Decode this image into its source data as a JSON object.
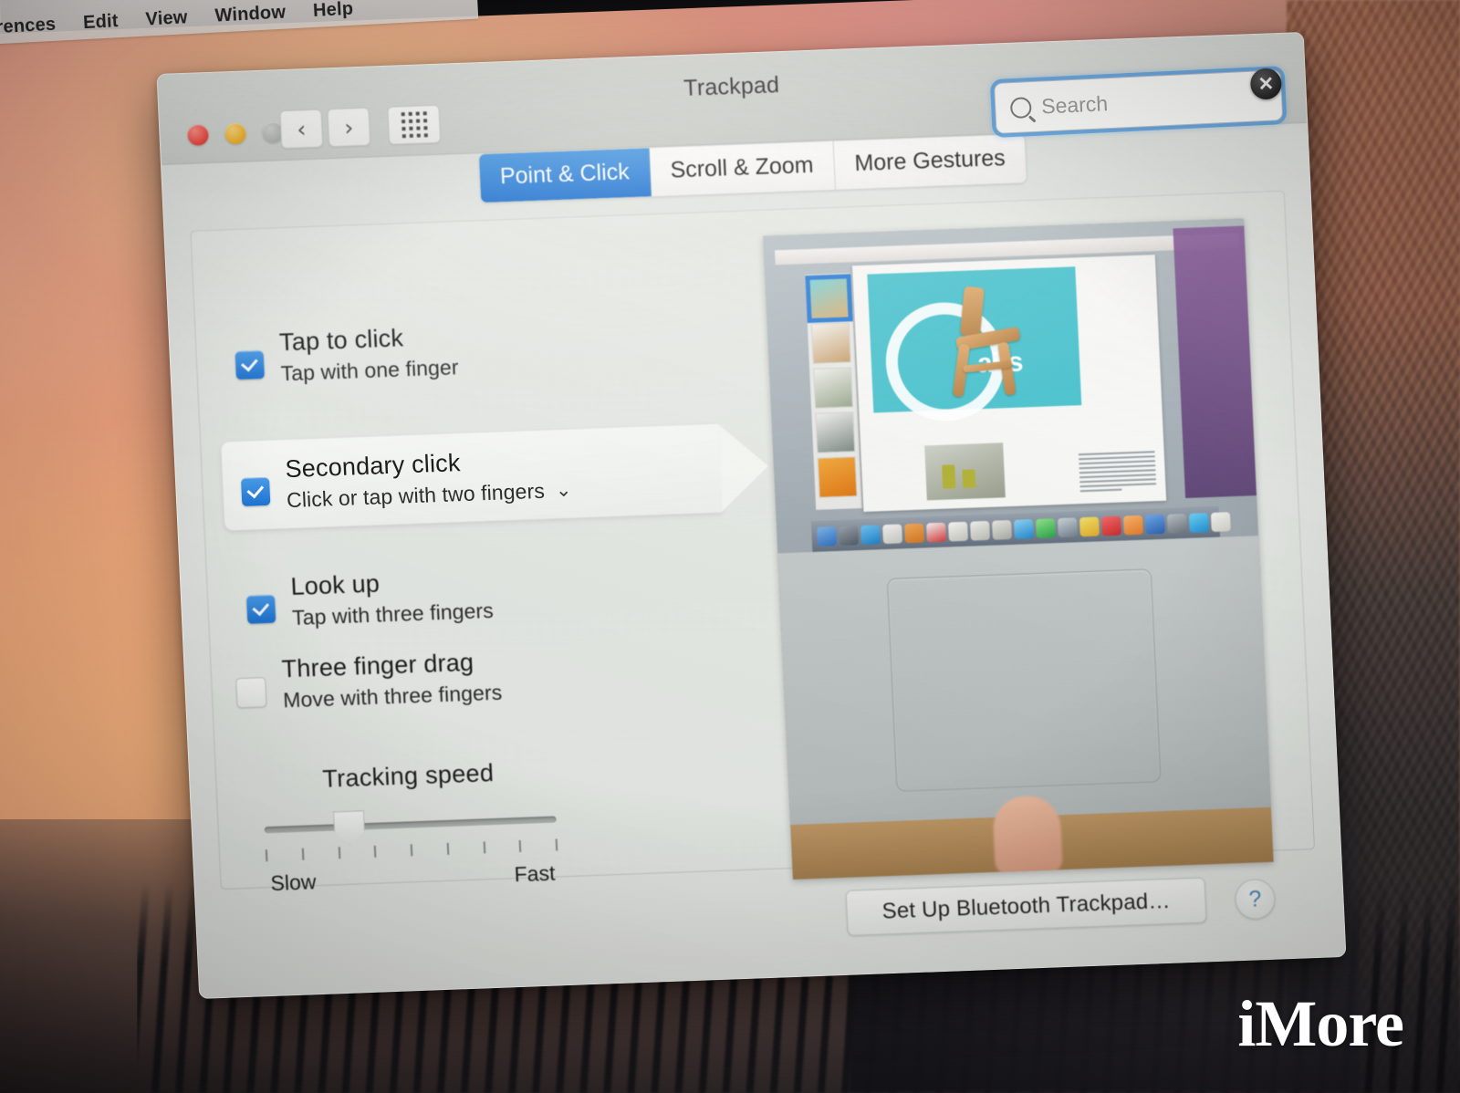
{
  "menubar": {
    "items": [
      {
        "label": "…erences"
      },
      {
        "label": "Edit"
      },
      {
        "label": "View"
      },
      {
        "label": "Window"
      },
      {
        "label": "Help"
      }
    ]
  },
  "window": {
    "title": "Trackpad",
    "traffic_lights": {
      "close": "close",
      "minimize": "minimize",
      "zoom": "zoom"
    },
    "nav": {
      "back": "‹",
      "forward": "›",
      "show_all": "show-all-grid"
    }
  },
  "search": {
    "placeholder": "Search",
    "value": "",
    "clear_glyph": "✕"
  },
  "tabs": [
    {
      "label": "Point & Click",
      "active": true
    },
    {
      "label": "Scroll & Zoom",
      "active": false
    },
    {
      "label": "More Gestures",
      "active": false
    }
  ],
  "options": [
    {
      "title": "Tap to click",
      "subtitle": "Tap with one finger",
      "checked": true,
      "has_dropdown": false
    },
    {
      "title": "Secondary click",
      "subtitle": "Click or tap with two fingers",
      "checked": true,
      "has_dropdown": true,
      "dropdown_glyph": "⌄",
      "highlighted": true
    },
    {
      "title": "Look up",
      "subtitle": "Tap with three fingers",
      "checked": true,
      "has_dropdown": false
    },
    {
      "title": "Three finger drag",
      "subtitle": "Move with three fingers",
      "checked": false,
      "has_dropdown": false
    }
  ],
  "slider": {
    "label": "Tracking speed",
    "min_label": "Slow",
    "max_label": "Fast",
    "tick_count": 9,
    "value_position_percent": 25
  },
  "footer": {
    "setup_button": "Set Up Bluetooth Trackpad…",
    "help_button": "?"
  },
  "watermark": {
    "text": "iMore"
  },
  "colors": {
    "accent_blue": "#1c73d2",
    "tab_active_blue": "#2d7fd8",
    "checkbox_blue": "#2a7fd6",
    "search_focus_ring": "#5aa0e2",
    "window_bg": "#e7ebe6",
    "titlebar_bg": "#d2d6d2"
  }
}
